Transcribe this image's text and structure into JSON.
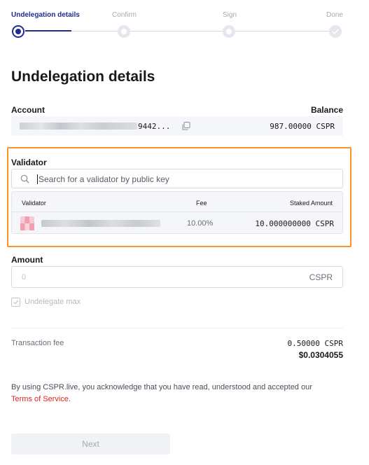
{
  "stepper": {
    "steps": [
      {
        "label": "Undelegation details",
        "state": "active"
      },
      {
        "label": "Confirm",
        "state": "pending"
      },
      {
        "label": "Sign",
        "state": "pending"
      },
      {
        "label": "Done",
        "state": "done"
      }
    ]
  },
  "page": {
    "title": "Undelegation details"
  },
  "account": {
    "label": "Account",
    "balance_label": "Balance",
    "key_short": "9442...",
    "balance": "987.00000 CSPR"
  },
  "validator": {
    "label": "Validator",
    "search_placeholder": "Search for a validator by public key",
    "table": {
      "headers": [
        "Validator",
        "Fee",
        "Staked Amount"
      ],
      "rows": [
        {
          "fee": "10.00%",
          "staked": "10.000000000 CSPR"
        }
      ]
    }
  },
  "amount": {
    "label": "Amount",
    "placeholder": "0",
    "unit": "CSPR",
    "checkbox_label": "Undelegate max"
  },
  "fee": {
    "label": "Transaction fee",
    "cspr": "0.50000 CSPR",
    "usd": "$0.0304055"
  },
  "terms": {
    "text": "By using CSPR.live, you acknowledge that you have read, understood and accepted our",
    "link": "Terms of Service",
    "suffix": "."
  },
  "actions": {
    "next_label": "Next"
  },
  "colors": {
    "accent": "#1e2d92",
    "highlight_frame": "#f7941d",
    "link": "#e1251b"
  }
}
